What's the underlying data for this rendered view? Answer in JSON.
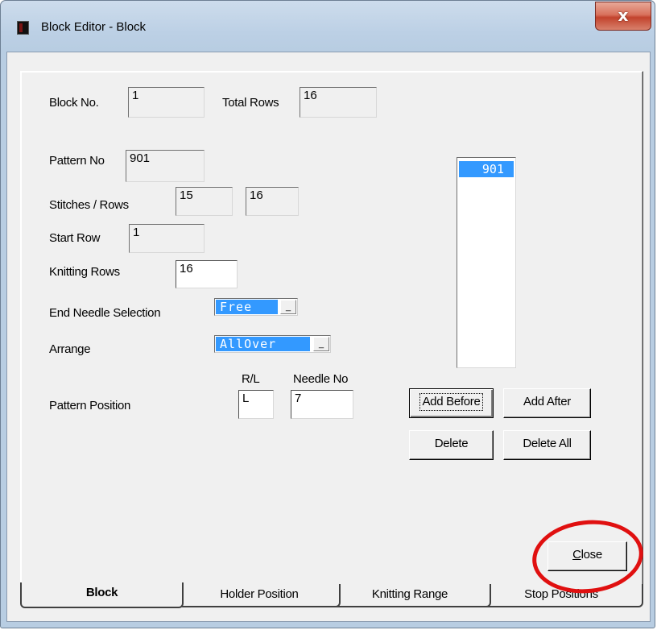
{
  "window": {
    "title": "Block Editor - Block",
    "close_glyph": "x"
  },
  "block": {
    "block_no_label": "Block No.",
    "block_no_value": "1",
    "total_rows_label": "Total Rows",
    "total_rows_value": "16"
  },
  "pattern": {
    "pattern_no_label": "Pattern No",
    "pattern_no_value": "901",
    "stitches_rows_label": "Stitches / Rows",
    "stitches_value": "15",
    "rows_value": "16",
    "start_row_label": "Start Row",
    "start_row_value": "1",
    "knitting_rows_label": "Knitting Rows",
    "knitting_rows_value": "16",
    "end_needle_label": "End Needle Selection",
    "end_needle_value": "Free",
    "arrange_label": "Arrange",
    "arrange_value": "AllOver",
    "combo_arrow": "_",
    "rl_label": "R/L",
    "needle_no_label": "Needle No",
    "pattern_position_label": "Pattern Position",
    "rl_value": "L",
    "needle_no_value": "7"
  },
  "pattern_list": {
    "items": [
      "901"
    ]
  },
  "buttons": {
    "add_before": "Add Before",
    "add_after": "Add After",
    "delete": "Delete",
    "delete_all": "Delete All",
    "close_first": "C",
    "close_rest": "lose"
  },
  "tabs": [
    "Block",
    "Holder Position",
    "Knitting Range",
    "Stop Positions"
  ],
  "colors": {
    "selection": "#3399ff",
    "annotation": "#e01010",
    "title_bar": "#bcd0e5"
  }
}
